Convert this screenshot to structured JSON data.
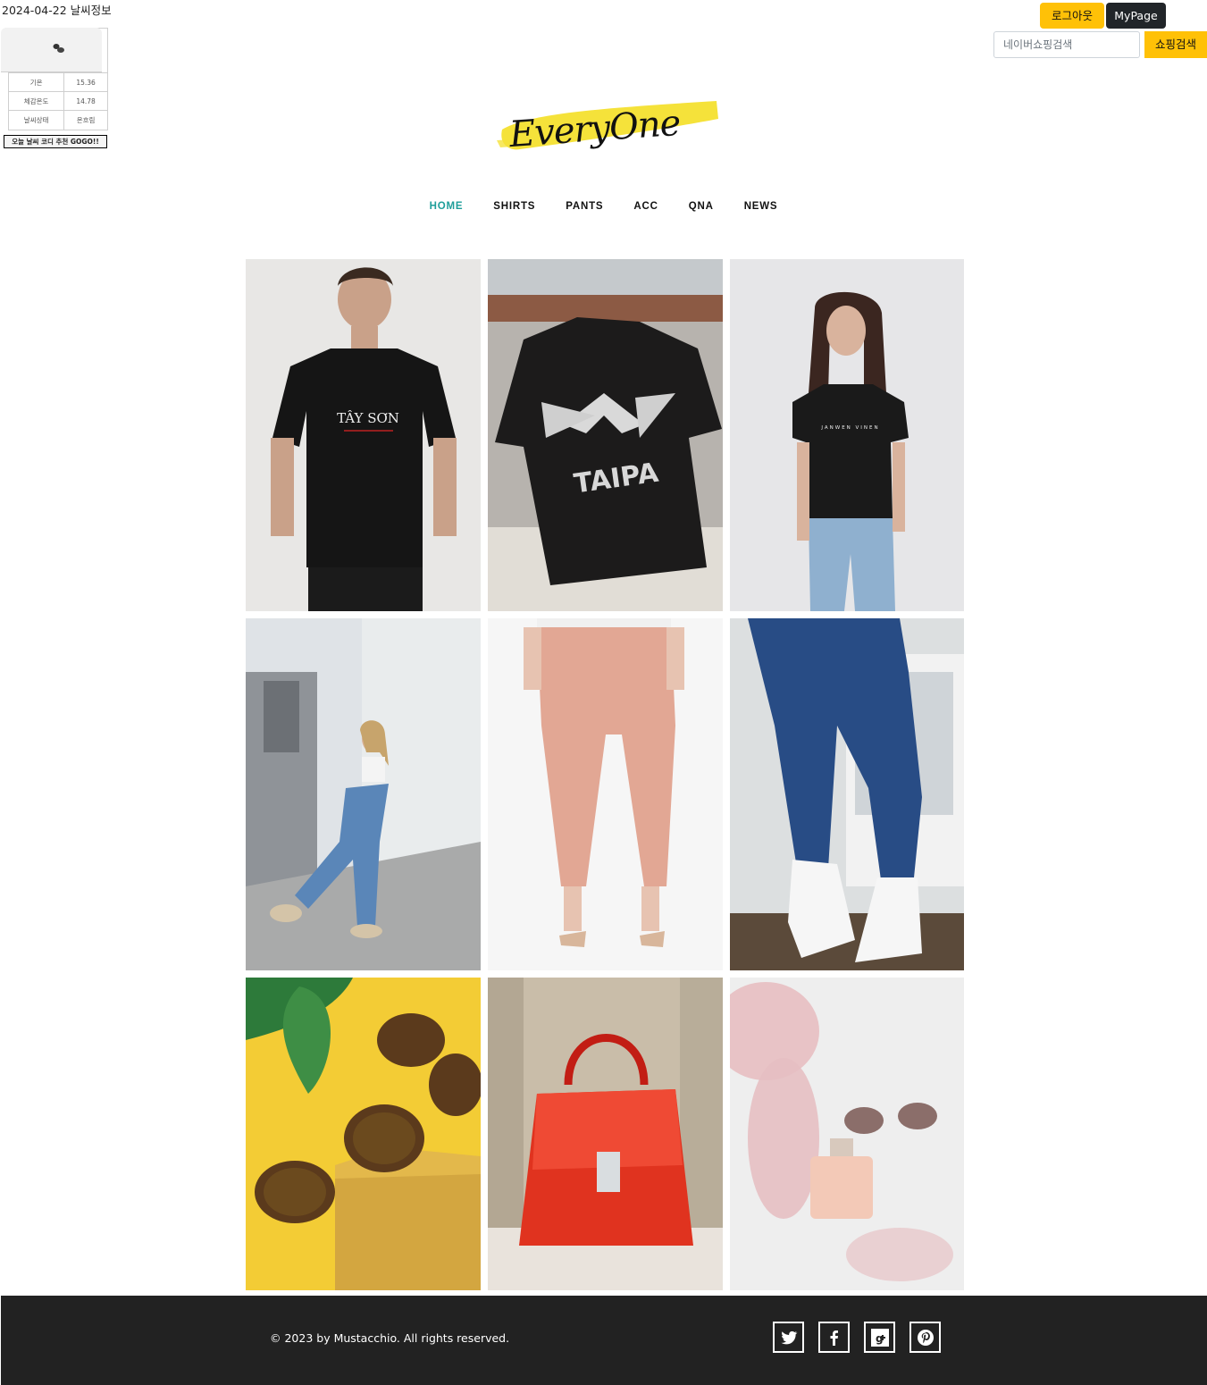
{
  "weather": {
    "date_title": "2024-04-22 날씨정보",
    "icon": "cloud-icon",
    "rows": [
      {
        "label": "기온",
        "value": "15.36"
      },
      {
        "label": "체감온도",
        "value": "14.78"
      },
      {
        "label": "날씨상태",
        "value": "온흐림"
      }
    ],
    "recommend_button": "오늘 날씨 코디 추천 GOGO!!"
  },
  "header": {
    "logout_label": "로그아웃",
    "mypage_label": "MyPage",
    "search_placeholder": "네이버쇼핑검색",
    "search_button": "쇼핑검색",
    "logo_text": "EveryOne"
  },
  "nav": {
    "items": [
      "HOME",
      "SHIRTS",
      "PANTS",
      "ACC",
      "QNA",
      "NEWS"
    ],
    "active": "HOME"
  },
  "gallery": {
    "items": [
      {
        "category": "shirts",
        "shirt_print": "TÂY SƠN"
      },
      {
        "category": "shirts",
        "shirt_print": "TAIPA"
      },
      {
        "category": "shirts",
        "shirt_print": "JANWEN VINEN"
      },
      {
        "category": "pants"
      },
      {
        "category": "pants"
      },
      {
        "category": "pants"
      },
      {
        "category": "acc"
      },
      {
        "category": "acc"
      },
      {
        "category": "acc"
      }
    ]
  },
  "footer": {
    "copyright": "© 2023 by Mustacchio. All rights reserved.",
    "social": [
      "twitter-icon",
      "facebook-icon",
      "google-plus-icon",
      "pinterest-icon"
    ]
  },
  "colors": {
    "accent_yellow": "#ffc107",
    "dark": "#212529",
    "nav_active": "#1e9e9a",
    "footer_bg": "#222222"
  }
}
